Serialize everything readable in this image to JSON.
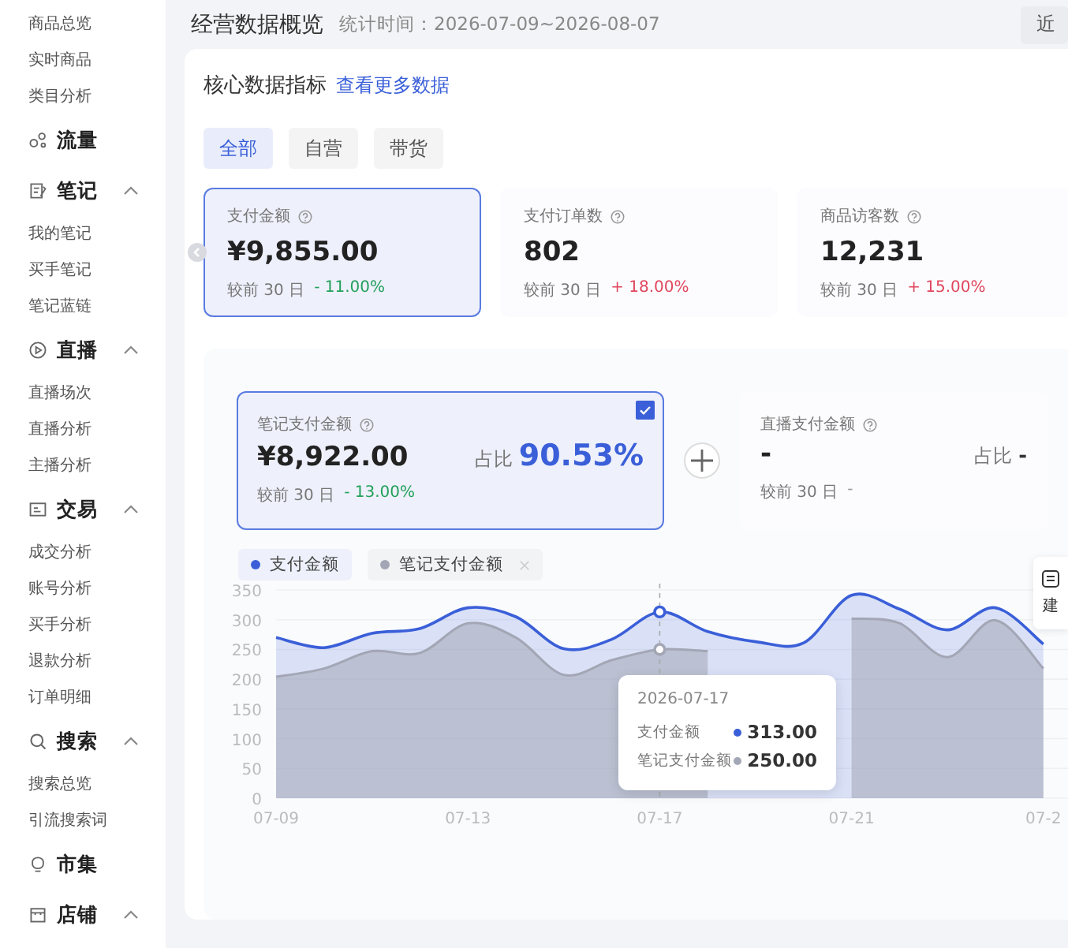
{
  "sidebar": {
    "groups": [
      {
        "items": [
          "商品总览",
          "实时商品",
          "类目分析"
        ]
      },
      {
        "title": "流量"
      },
      {
        "title": "笔记",
        "expanded": true,
        "items": [
          "我的笔记",
          "买手笔记",
          "笔记蓝链"
        ]
      },
      {
        "title": "直播",
        "expanded": true,
        "items": [
          "直播场次",
          "直播分析",
          "主播分析"
        ]
      },
      {
        "title": "交易",
        "expanded": true,
        "items": [
          "成交分析",
          "账号分析",
          "买手分析",
          "退款分析",
          "订单明细"
        ]
      },
      {
        "title": "搜索",
        "expanded": true,
        "items": [
          "搜索总览",
          "引流搜索词"
        ]
      },
      {
        "title": "市集"
      },
      {
        "title": "店铺",
        "expanded": true
      }
    ]
  },
  "header": {
    "title": "经营数据概览",
    "period": "统计时间：2026-07-09~2026-08-07",
    "range_button": "近"
  },
  "section": {
    "title": "核心数据指标",
    "link": "查看更多数据"
  },
  "tabs": [
    {
      "label": "全部",
      "selected": true
    },
    {
      "label": "自营",
      "selected": false
    },
    {
      "label": "带货",
      "selected": false
    }
  ],
  "metrics": [
    {
      "label": "支付金额",
      "value": "¥9,855.00",
      "compare": "较前 30 日",
      "delta": "- 11.00%",
      "color": "#22a05a",
      "selected": true
    },
    {
      "label": "支付订单数",
      "value": "802",
      "compare": "较前 30 日",
      "delta": "+ 18.00%",
      "color": "#e0475e",
      "selected": false
    },
    {
      "label": "商品访客数",
      "value": "12,231",
      "compare": "较前 30 日",
      "delta": "+ 15.00%",
      "color": "#e0475e",
      "selected": false
    }
  ],
  "breakdown": [
    {
      "label": "笔记支付金额",
      "value": "¥8,922.00",
      "share_label": "占比",
      "share": "90.53%",
      "compare": "较前 30 日",
      "delta": "- 13.00%",
      "color": "#22a05a",
      "selected": true,
      "checked": true
    },
    {
      "label": "直播支付金额",
      "value": "-",
      "share_label": "占比",
      "share": "-",
      "compare": "较前 30 日",
      "delta": "-",
      "color": "#999999",
      "selected": false,
      "checked": false
    }
  ],
  "side_widget": {
    "label": "建"
  },
  "chart": {
    "legend": [
      {
        "active": true
      },
      {
        "active": false
      }
    ],
    "tooltip": {
      "date": "2026-07-17",
      "rows": [
        {
          "name": "支付金额",
          "value": "313.00",
          "color": "#3a5fd8"
        },
        {
          "name": "笔记支付金额",
          "value": "250.00",
          "color": "#a3a6b4"
        }
      ]
    },
    "chart_data": {
      "type": "area",
      "grid": true,
      "legend": "top-left",
      "categories": [
        "07-09",
        null,
        null,
        null,
        "07-13",
        null,
        null,
        null,
        "07-17",
        null,
        null,
        null,
        "07-21",
        null,
        null,
        null,
        "07-2"
      ],
      "series": [
        {
          "name": "支付金额",
          "color": "#3a5fd8",
          "values": [
            270,
            253,
            277,
            285,
            320,
            305,
            251,
            267,
            313,
            280,
            263,
            261,
            341,
            318,
            283,
            320,
            259
          ]
        },
        {
          "name": "笔记支付金额",
          "color": "#a3a6b4",
          "values": [
            204,
            218,
            247,
            244,
            294,
            270,
            207,
            232,
            250,
            247,
            null,
            null,
            302,
            294,
            237,
            299,
            218
          ]
        }
      ],
      "ylim": [
        0,
        350
      ],
      "yticks": [
        0,
        50,
        100,
        150,
        200,
        250,
        300,
        350
      ]
    }
  }
}
